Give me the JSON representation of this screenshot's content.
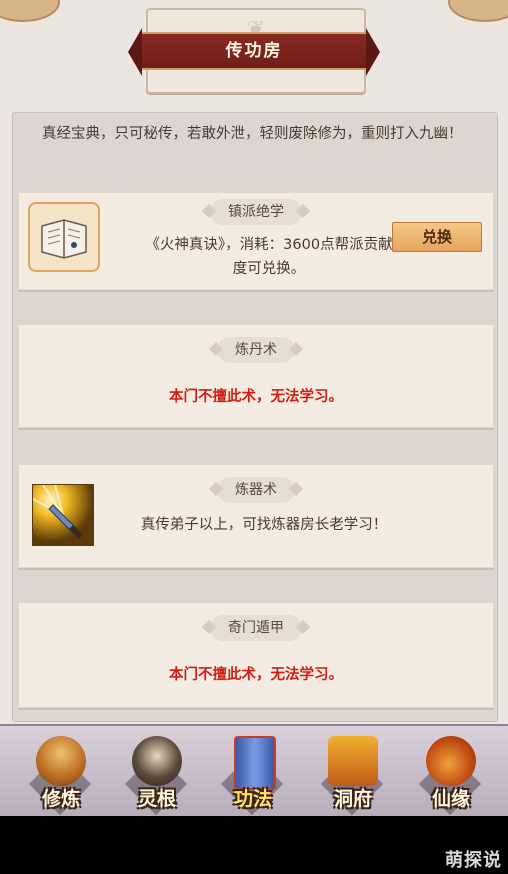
{
  "title": "传功房",
  "intro": "真经宝典，只可秘传，若敢外泄，轻则废除修为，重则打入九幽！",
  "cards": [
    {
      "tag": "镇派绝学",
      "desc": "《火神真诀》，消耗：3600点帮派贡献度可兑换。",
      "button": "兑换",
      "icon": "book-icon"
    },
    {
      "tag": "炼丹术",
      "desc": "本门不擅此术，无法学习。"
    },
    {
      "tag": "炼器术",
      "desc": "真传弟子以上，可找炼器房长老学习！",
      "icon": "sword-icon"
    },
    {
      "tag": "奇门遁甲",
      "desc": "本门不擅此术，无法学习。"
    }
  ],
  "nav": [
    {
      "label": "修炼",
      "icon": "hooded-figure-icon"
    },
    {
      "label": "灵根",
      "icon": "warrior-icon"
    },
    {
      "label": "功法",
      "icon": "scroll-book-icon",
      "active": true
    },
    {
      "label": "洞府",
      "icon": "pagoda-icon"
    },
    {
      "label": "仙缘",
      "icon": "gourd-icon"
    }
  ],
  "watermark": "萌探说",
  "colors": {
    "accent_red": "#d01e12",
    "ribbon": "#7a231e",
    "button": "#eeb46e"
  }
}
